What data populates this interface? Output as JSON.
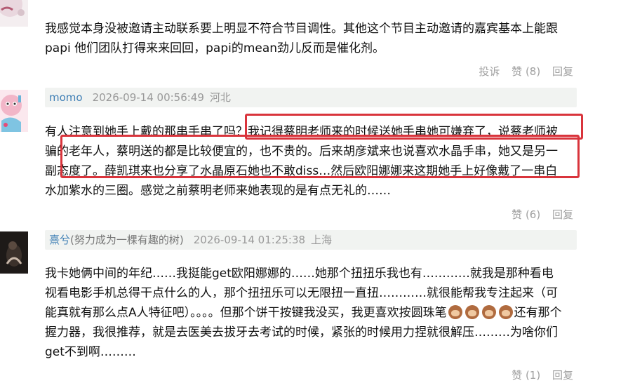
{
  "comments": [
    {
      "text_line1": "我感觉本身没被邀请主动联系要上明显不符合节目调性。其他这个节目主动邀请的嘉宾基本上能跟",
      "text_line2": "papi 他们团队打得来来回回，papi的mean劲儿反而是催化剂。",
      "report_label": "投诉",
      "like_label": "赞 (8)",
      "reply_label": "回复"
    },
    {
      "username": "momo",
      "timestamp": "2026-09-14 00:56:49",
      "location": "河北",
      "text_line1": "有人注意到她手上戴的那串手串了吗？我记得蔡明老师来的时候送她手串她可嫌弃了，说蔡老师被",
      "text_line2": "骗的老年人，蔡明送的都是比较便宜的，也不贵的。后来胡彦斌来也说喜欢水晶手串，她又是另一",
      "text_line3": "副态度了。薛凯琪来也分享了水晶原石她也不敢diss…然后欧阳娜娜来这期她手上好像戴了一串白",
      "text_line4": "水加紫水的三圈。感觉之前蔡明老师来她表现的是有点无礼的……",
      "like_label": "赞 (6)",
      "reply_label": "回复"
    },
    {
      "username": "熹兮",
      "signature": "(努力成为一棵有趣的树)",
      "timestamp": "2026-09-14 01:25:38",
      "location": "上海",
      "text_line1": "我卡她俩中间的年纪……我挺能get欧阳娜娜的……她那个扭扭乐我也有…………就我是那种看电",
      "text_line2": "视看电影手机总得干点什么的人，那个扭扭乐可以无限扭一直扭…………就很能帮我专注起来（可",
      "text_line3": "能真就有那么点A人特征吧）。。。。但那个饼干按键我没买，我更喜欢按圆珠笔",
      "text_line3_after": "还有那个",
      "text_line4": "握力器，我很推荐，就是去医美去拔牙去考试的时候，紧张的时候用力捏就很解压………为啥你们",
      "text_line5": "get不到啊………",
      "like_label": "赞 (1)",
      "reply_label": "回复"
    }
  ],
  "emoji_name": "see-no-evil-monkey-icon",
  "colors": {
    "username": "#3f7fb5",
    "meta_bg": "#f1f3f1",
    "highlight": "#d9343c",
    "muted": "#999999"
  }
}
